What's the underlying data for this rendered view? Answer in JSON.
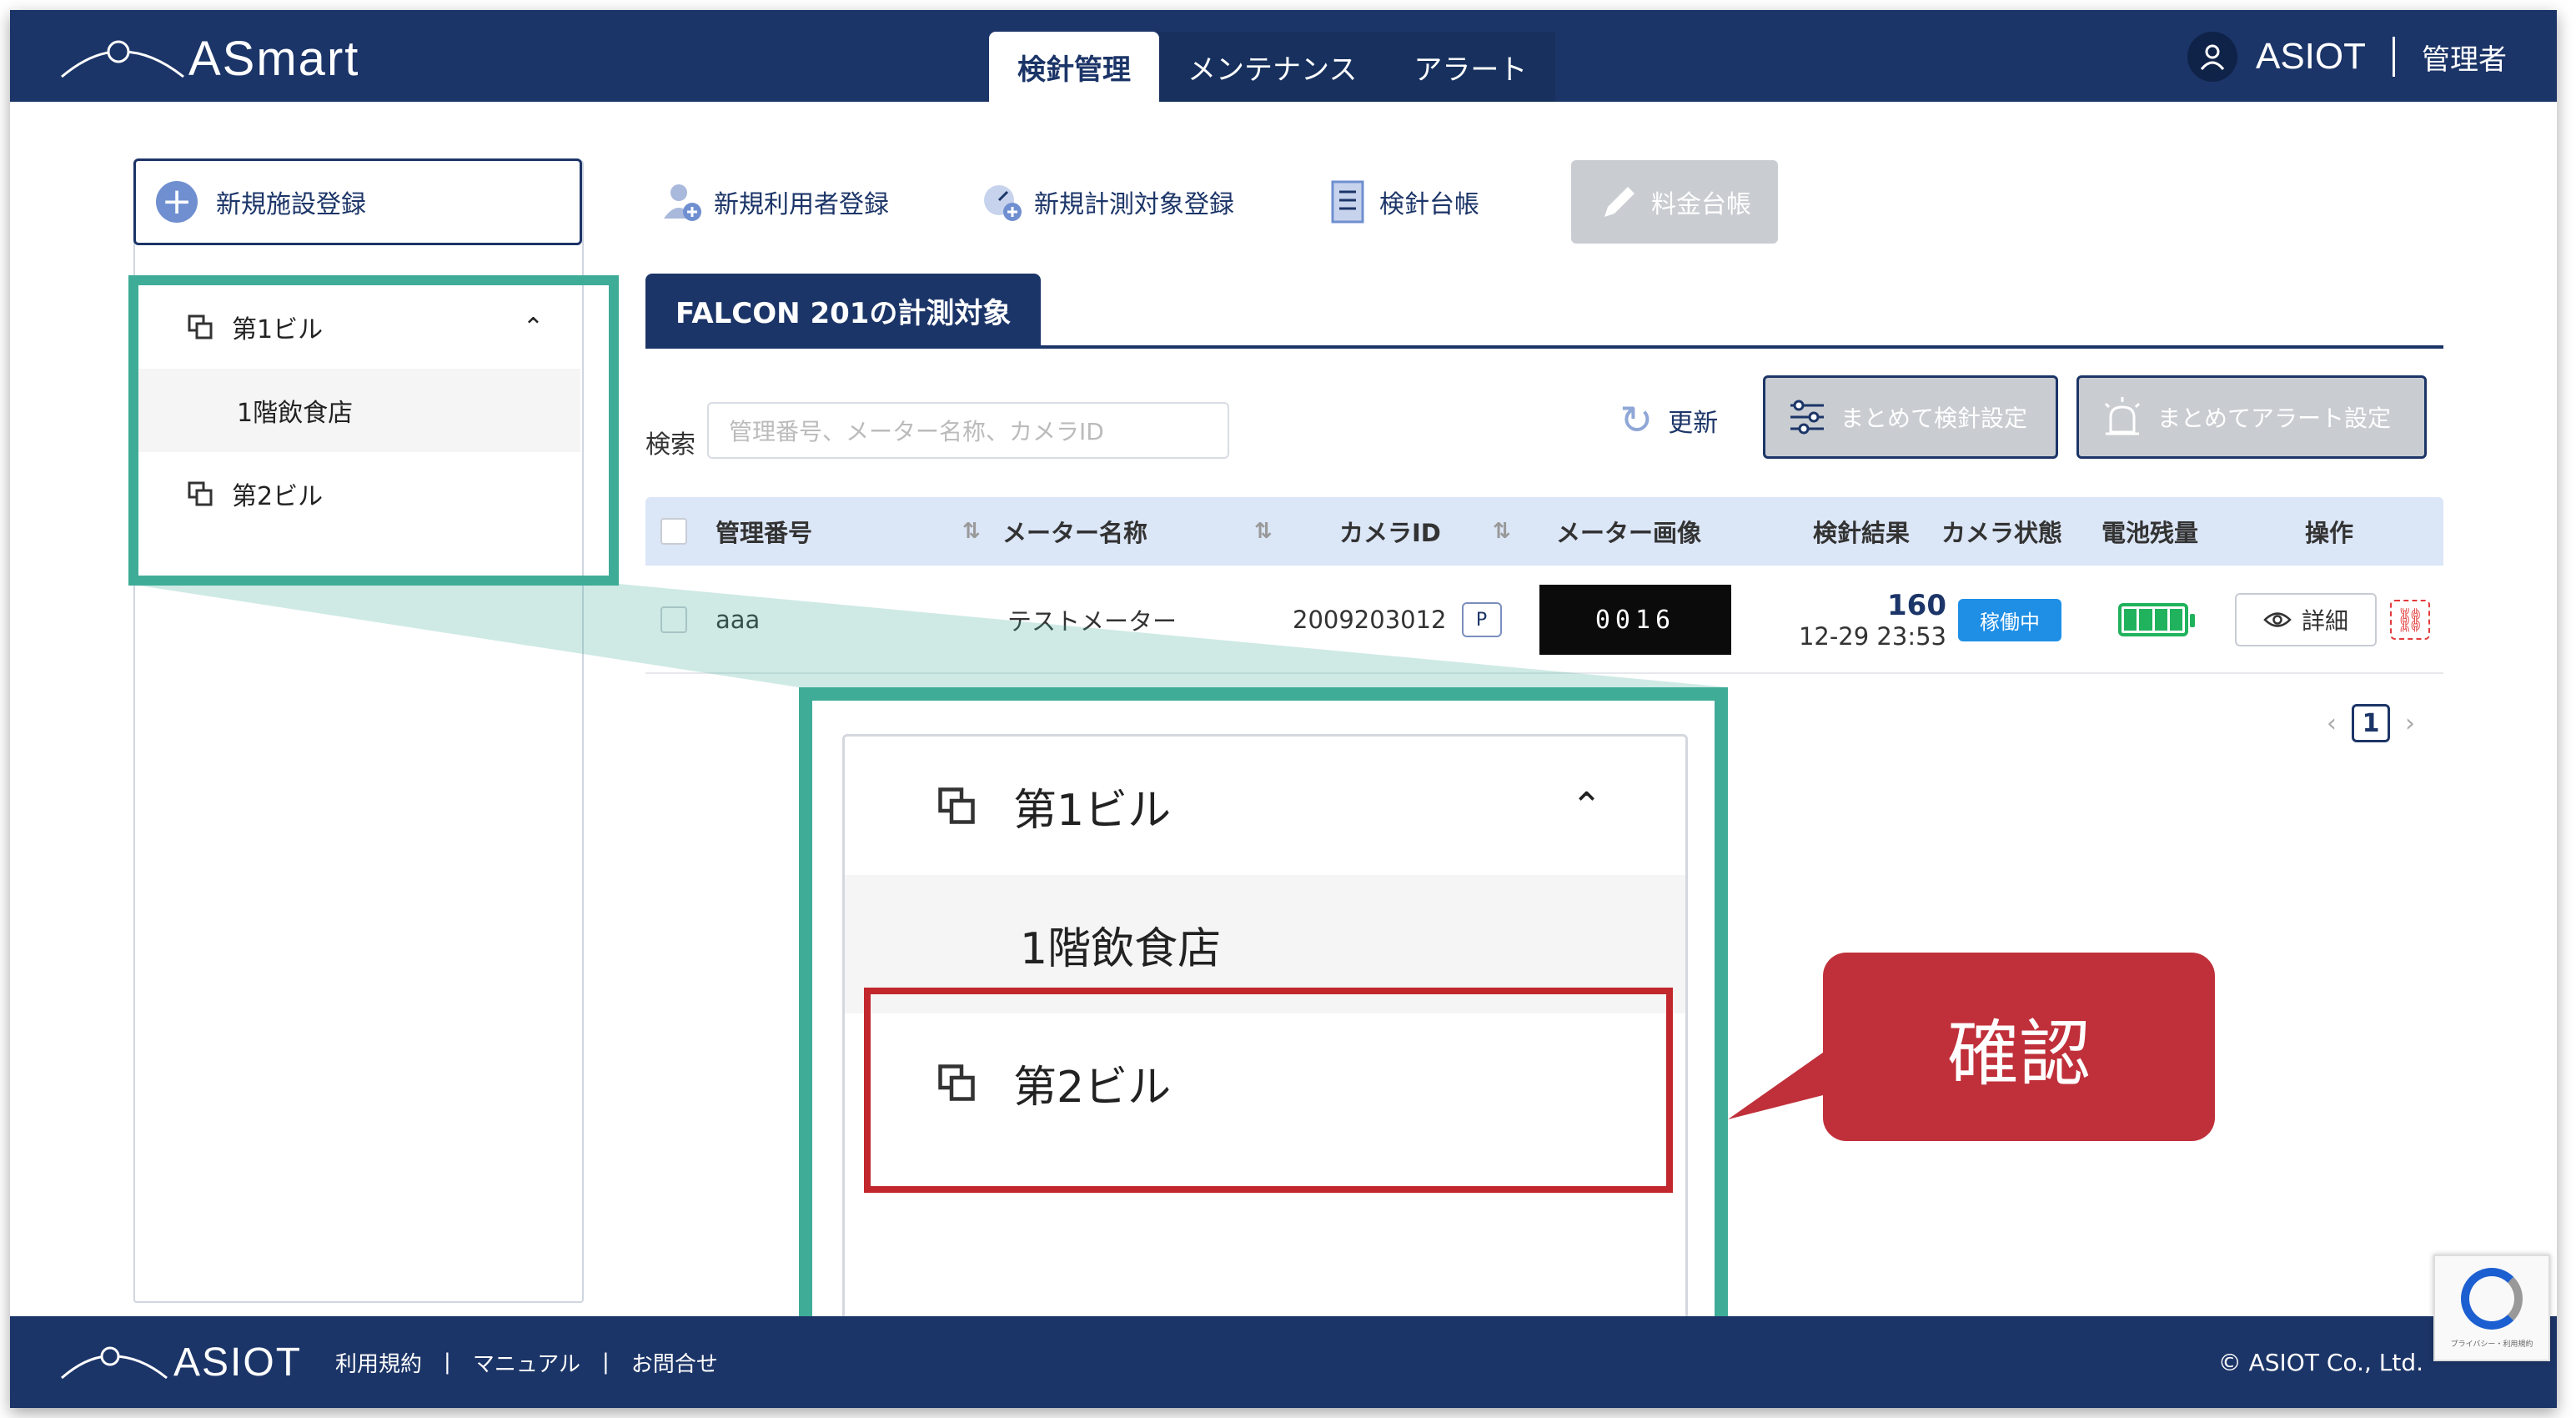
{
  "app": {
    "logo_text": "ASmart"
  },
  "header": {
    "tabs": [
      {
        "label": "検針管理"
      },
      {
        "label": "メンテナンス"
      },
      {
        "label": "アラート"
      }
    ],
    "user_name": "ASIOT",
    "user_role": "管理者"
  },
  "sidebar": {
    "new_facility_label": "新規施設登録",
    "tree": [
      {
        "label": "第1ビル"
      },
      {
        "label": "1階飲食店"
      },
      {
        "label": "第2ビル"
      }
    ]
  },
  "toolbar": {
    "new_user": "新規利用者登録",
    "new_target": "新規計測対象登録",
    "ledger": "検針台帳",
    "fee_ledger": "料金台帳"
  },
  "section": {
    "title": "FALCON 201の計測対象"
  },
  "search": {
    "label": "検索",
    "placeholder": "管理番号、メーター名称、カメラID"
  },
  "actions": {
    "refresh": "更新",
    "bulk_reading": "まとめて検針設定",
    "bulk_alert": "まとめてアラート設定"
  },
  "table": {
    "headers": {
      "mgmt_no": "管理番号",
      "meter_name": "メーター名称",
      "camera_id": "カメラID",
      "meter_image": "メーター画像",
      "result": "検針結果",
      "camera_status": "カメラ状態",
      "battery": "電池残量",
      "operation": "操作"
    },
    "rows": [
      {
        "mgmt_no": "aaa",
        "meter_name": "テストメーター",
        "camera_id": "2009203012",
        "camera_badge": "P",
        "meter_reading_display": "0016",
        "result_value": "160",
        "result_time": "12-29 23:53",
        "camera_status": "稼働中",
        "battery_level": 1.0,
        "detail_label": "詳細"
      }
    ]
  },
  "pagination": {
    "current": "1"
  },
  "zoom": {
    "items": [
      {
        "label": "第1ビル"
      },
      {
        "label": "1階飲食店"
      },
      {
        "label": "第2ビル"
      }
    ]
  },
  "callout": {
    "text": "確認"
  },
  "footer": {
    "logo_text": "ASIOT",
    "links": [
      "利用規約",
      "マニュアル",
      "お問合せ"
    ],
    "copyright": "© ASIOT Co., Ltd."
  },
  "recaptcha": {
    "text": "プライバシー・利用規約"
  },
  "colors": {
    "brand": "#1c3568",
    "accent": "#3fac98",
    "alert": "#c0303a",
    "status": "#1f8fe6",
    "battery": "#20b25c"
  }
}
